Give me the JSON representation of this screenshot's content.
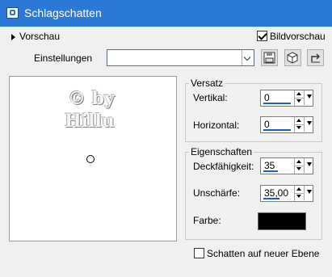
{
  "window": {
    "title": "Schlagschatten"
  },
  "preview": {
    "toggle_label": "Vorschau",
    "bildvorschau_label": "Bildvorschau",
    "bildvorschau_checked": true
  },
  "settings": {
    "label": "Einstellungen",
    "value": ""
  },
  "watermark": {
    "line1": "© by",
    "line2": "Hillu"
  },
  "versatz": {
    "title": "Versatz",
    "vertikal_label": "Vertikal:",
    "vertikal_value": "0",
    "horizontal_label": "Horizontal:",
    "horizontal_value": "0"
  },
  "eigenschaften": {
    "title": "Eigenschaften",
    "deckfaehigkeit_label": "Deckfähigkeit:",
    "deckfaehigkeit_value": "35",
    "unschaerfe_label": "Unschärfe:",
    "unschaerfe_value": "35,00",
    "farbe_label": "Farbe:",
    "farbe_color": "#000000"
  },
  "shadow_new_layer": {
    "label": "Schatten auf neuer Ebene",
    "checked": false
  },
  "colors": {
    "titlebar": "#2b78d6",
    "accent": "#1c5fc2"
  },
  "icons": [
    "app-icon",
    "expand-triangle-icon",
    "save-icon",
    "cube-icon",
    "reset-icon"
  ]
}
